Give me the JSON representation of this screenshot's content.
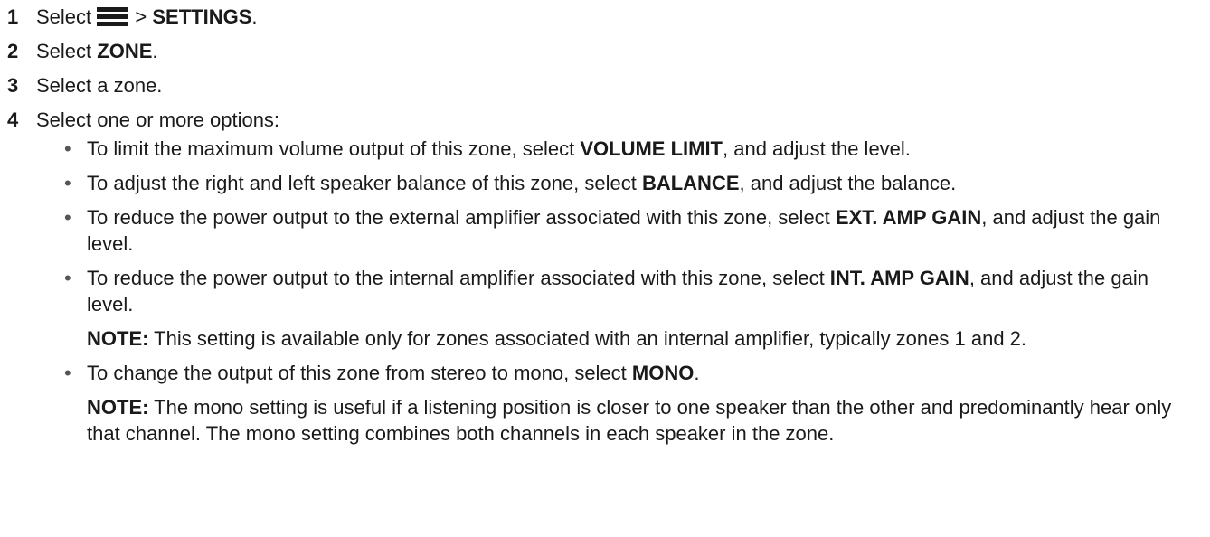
{
  "steps": [
    {
      "num": "1",
      "prefix": "Select",
      "icon": "menu-icon",
      "middle": " > ",
      "bold": "SETTINGS",
      "suffix": "."
    },
    {
      "num": "2",
      "prefix": "Select ",
      "bold": "ZONE",
      "suffix": "."
    },
    {
      "num": "3",
      "text": "Select a zone."
    },
    {
      "num": "4",
      "text": "Select one or more options:"
    }
  ],
  "bullets": [
    {
      "pre": "To limit the maximum volume output of this zone, select ",
      "bold": "VOLUME LIMIT",
      "post": ", and adjust the level."
    },
    {
      "pre": "To adjust the right and left speaker balance of this zone, select ",
      "bold": "BALANCE",
      "post": ", and adjust the balance."
    },
    {
      "pre": "To reduce the power output to the external amplifier associated with this zone, select ",
      "bold": "EXT. AMP GAIN",
      "post": ", and adjust the gain level."
    },
    {
      "pre": "To reduce the power output to the internal amplifier associated with this zone, select ",
      "bold": "INT. AMP GAIN",
      "post": ", and adjust the gain level."
    },
    {
      "pre": "To change the output of this zone from stereo to mono, select ",
      "bold": "MONO",
      "post": "."
    }
  ],
  "notes": [
    {
      "label": "NOTE:",
      "text": " This setting is available only for zones associated with an internal amplifier, typically zones 1 and 2."
    },
    {
      "label": "NOTE:",
      "text": " The mono setting is useful if a listening position is closer to one speaker than the other and predominantly hear only that channel. The mono setting combines both channels in each speaker in the zone."
    }
  ],
  "bullet_glyph": "•",
  "colors": {
    "text": "#1a1a1a",
    "bullet": "#555555",
    "icon": "#1a1a1a"
  }
}
